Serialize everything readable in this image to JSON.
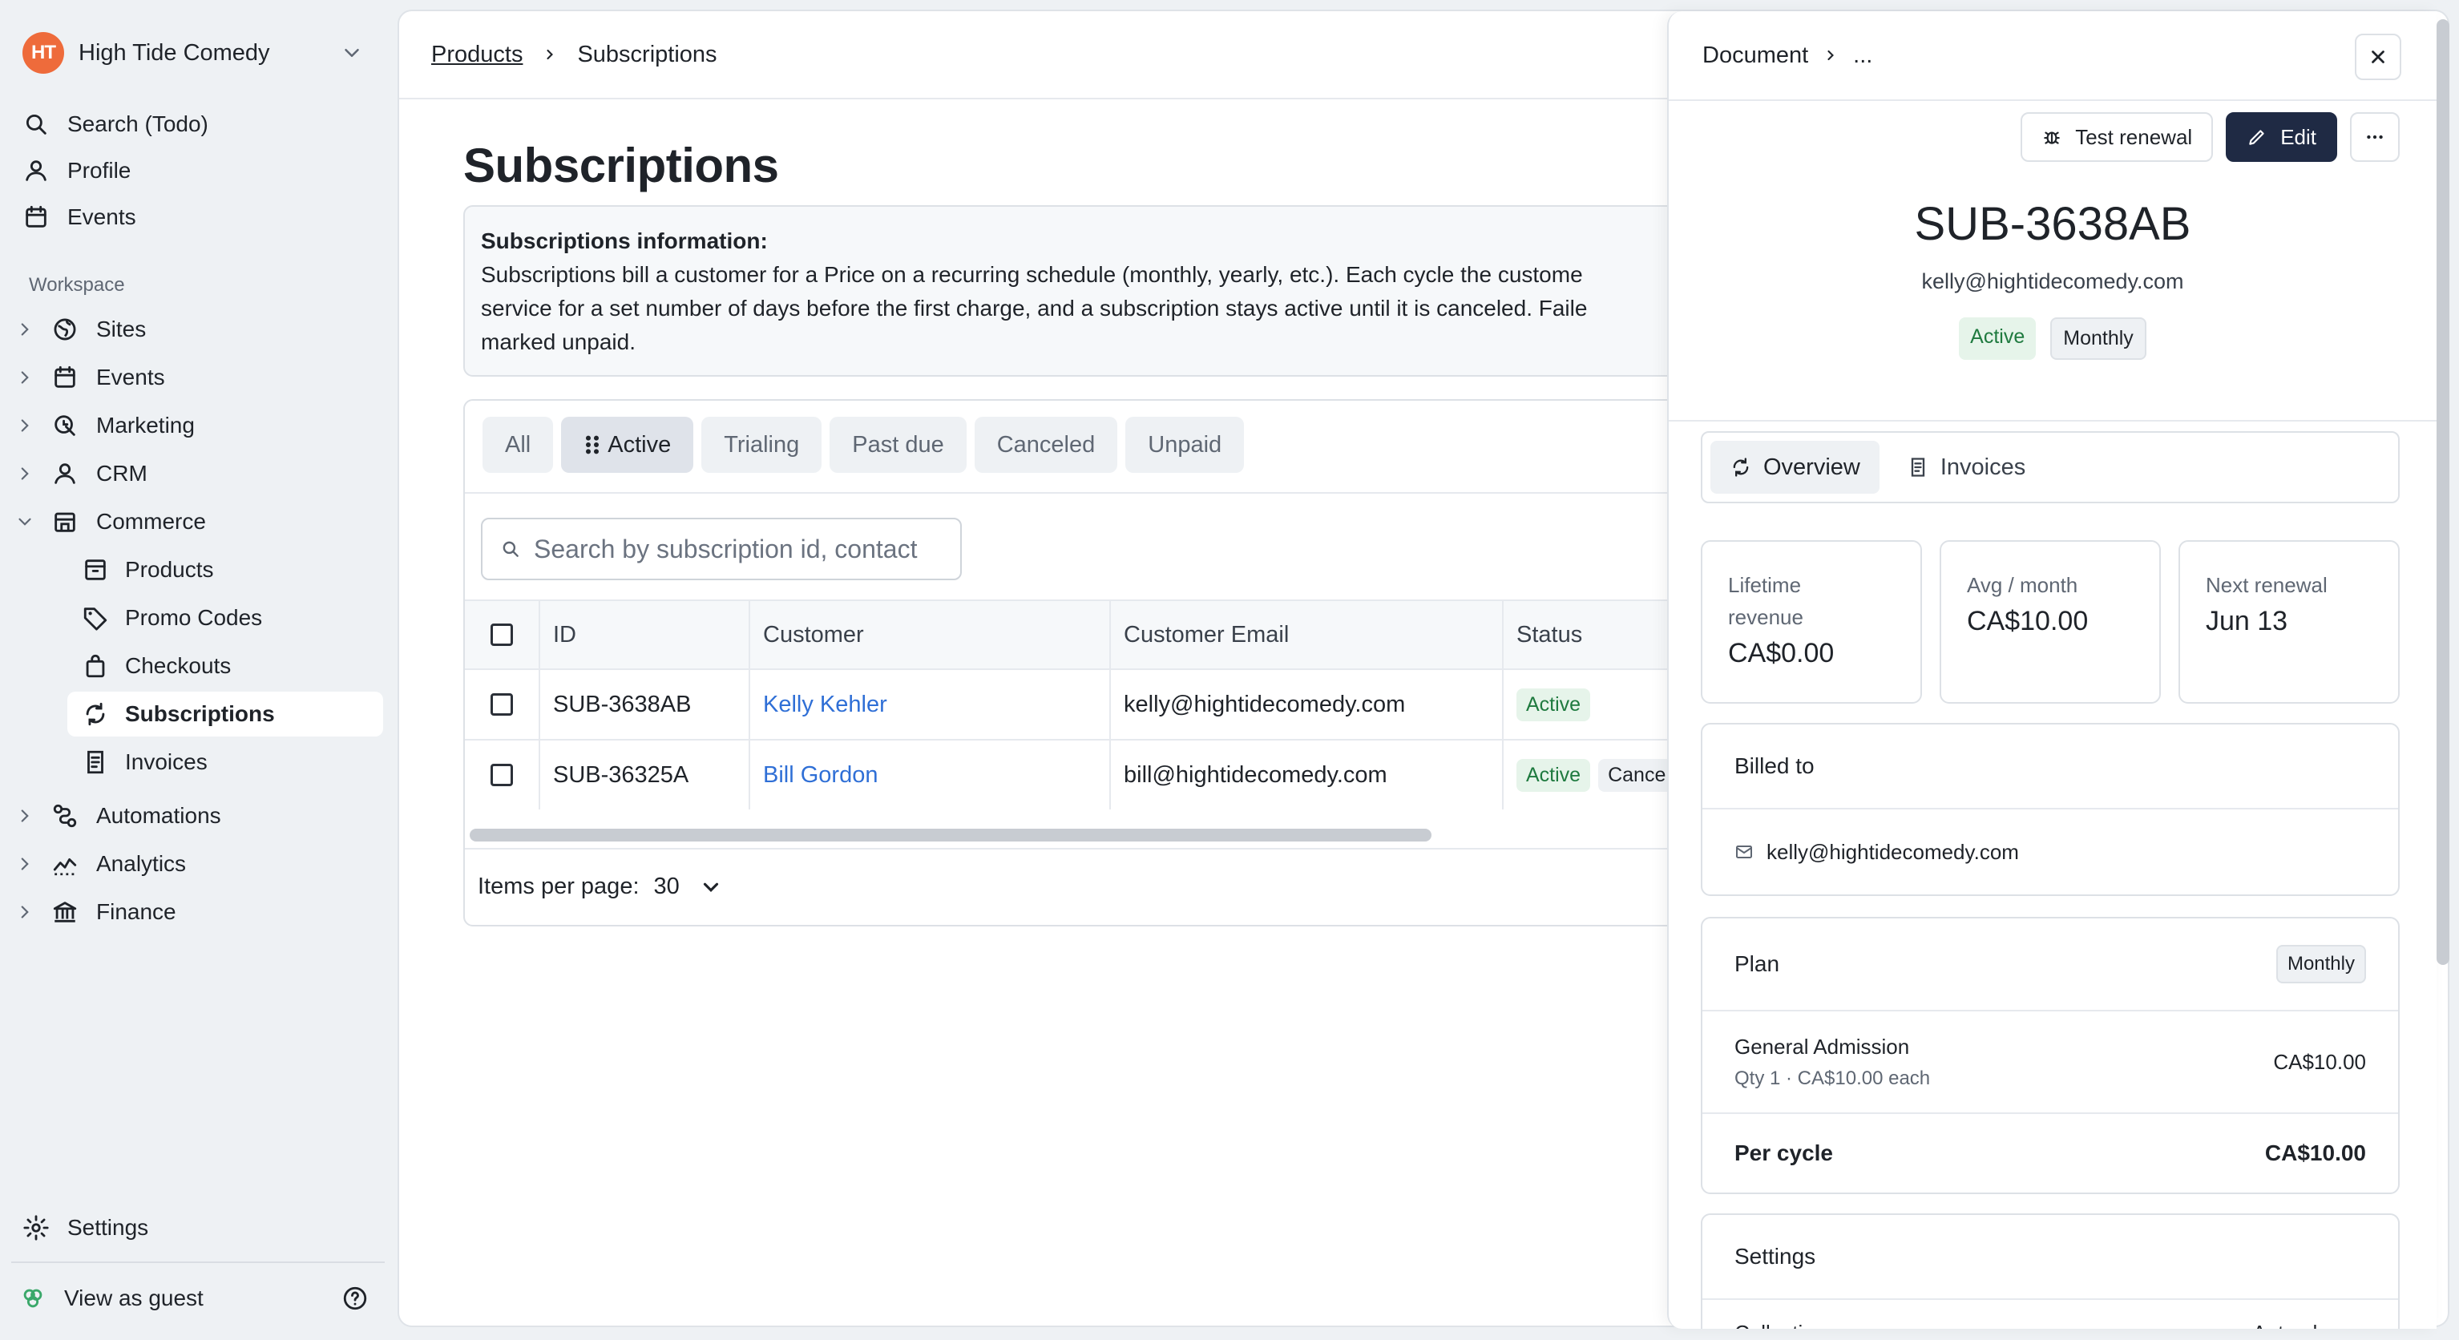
{
  "org": {
    "name": "High Tide Comedy",
    "logo_text": "HT",
    "logo_color": "#ee6b3b"
  },
  "nav": {
    "search": "Search (Todo)",
    "profile": "Profile",
    "events": "Events",
    "workspace_label": "Workspace",
    "sites": "Sites",
    "events2": "Events",
    "marketing": "Marketing",
    "crm": "CRM",
    "commerce": "Commerce",
    "products": "Products",
    "promo_codes": "Promo Codes",
    "checkouts": "Checkouts",
    "subscriptions": "Subscriptions",
    "invoices": "Invoices",
    "automations": "Automations",
    "analytics": "Analytics",
    "finance": "Finance",
    "settings": "Settings",
    "view_as_guest": "View as guest"
  },
  "breadcrumb": {
    "parent": "Products",
    "current": "Subscriptions"
  },
  "page": {
    "title": "Subscriptions",
    "info_title": "Subscriptions information:",
    "info_line1": "Subscriptions bill a customer for a Price on a recurring schedule (monthly, yearly, etc.). Each cycle the custome",
    "info_line2": "service for a set number of days before the first charge, and a subscription stays active until it is canceled. Faile",
    "info_line3": "marked unpaid."
  },
  "tabs": [
    "All",
    "Active",
    "Trialing",
    "Past due",
    "Canceled",
    "Unpaid"
  ],
  "active_tab": "Active",
  "search": {
    "placeholder": "Search by subscription id, contact"
  },
  "table": {
    "columns": [
      "ID",
      "Customer",
      "Customer Email",
      "Status"
    ],
    "rows": [
      {
        "id": "SUB-3638AB",
        "customer": "Kelly Kehler",
        "email": "kelly@hightidecomedy.com",
        "status": "Active",
        "extra": ""
      },
      {
        "id": "SUB-36325A",
        "customer": "Bill Gordon",
        "email": "bill@hightidecomedy.com",
        "status": "Active",
        "extra": "Cancels"
      }
    ]
  },
  "pager": {
    "label": "Items per page:",
    "value": "30"
  },
  "drawer": {
    "crumb": "Document",
    "crumb_more": "...",
    "test_renewal": "Test renewal",
    "edit": "Edit",
    "id": "SUB-3638AB",
    "email": "kelly@hightidecomedy.com",
    "status": "Active",
    "interval": "Monthly",
    "tab_overview": "Overview",
    "tab_invoices": "Invoices",
    "stats": [
      {
        "label": "Lifetime revenue",
        "value": "CA$0.00"
      },
      {
        "label": "Avg / month",
        "value": "CA$10.00"
      },
      {
        "label": "Next renewal",
        "value": "Jun 13"
      }
    ],
    "billed_to_title": "Billed to",
    "billed_to_email": "kelly@hightidecomedy.com",
    "plan_title": "Plan",
    "plan_badge": "Monthly",
    "plan_item": "General Admission",
    "plan_item_detail": "Qty 1 · CA$10.00 each",
    "plan_item_price": "CA$10.00",
    "per_cycle_label": "Per cycle",
    "per_cycle_value": "CA$10.00",
    "settings_title": "Settings",
    "collection_label": "Collection",
    "collection_value": "Auto-charge"
  },
  "colors": {
    "accent_dark": "#1f2a44",
    "link": "#2f6fd6",
    "success_bg": "#e6f4ea",
    "success_text": "#1f7a3f"
  }
}
